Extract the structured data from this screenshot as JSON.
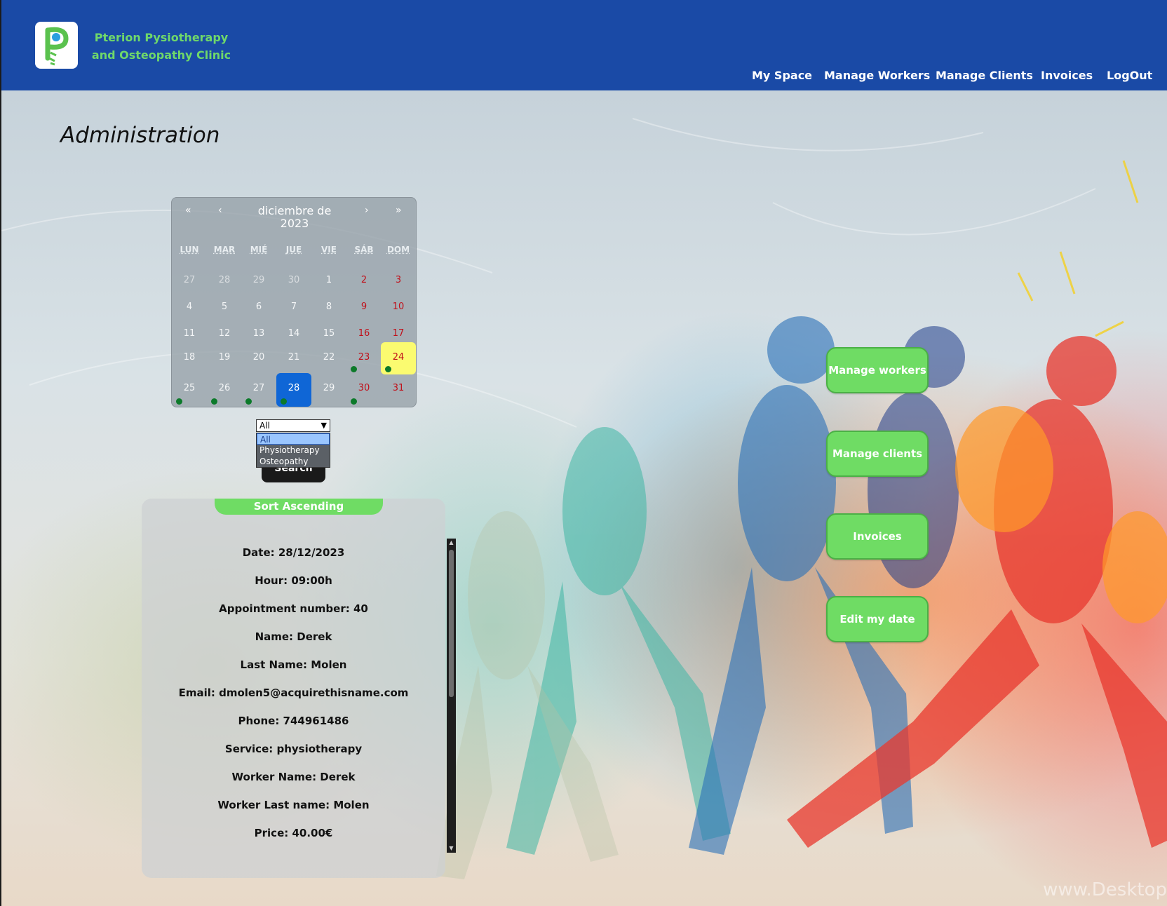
{
  "header": {
    "clinic_name": "Pterion Pysiotherapy and Osteopathy Clinic",
    "nav": [
      "My Space",
      "Manage Workers",
      "Manage Clients",
      "Invoices",
      "LogOut"
    ]
  },
  "page": {
    "title": "Administration",
    "watermark": "www.Desktop"
  },
  "calendar": {
    "prev_year": "«",
    "prev_month": "‹",
    "next_month": "›",
    "next_year": "»",
    "month_label": "diciembre de 2023",
    "weekdays": [
      "LUN",
      "MAR",
      "MIÉ",
      "JUE",
      "VIE",
      "SÁB",
      "DOM"
    ],
    "weeks": [
      [
        "27",
        "28",
        "29",
        "30",
        "1",
        "2",
        "3"
      ],
      [
        "4",
        "5",
        "6",
        "7",
        "8",
        "9",
        "10"
      ],
      [
        "11",
        "12",
        "13",
        "14",
        "15",
        "16",
        "17"
      ],
      [
        "18",
        "19",
        "20",
        "21",
        "22",
        "23",
        "24"
      ],
      [
        "25",
        "26",
        "27",
        "28",
        "29",
        "30",
        "31"
      ]
    ],
    "today": "24",
    "selected": "28",
    "days_with_appointments": [
      "23",
      "24",
      "25",
      "26",
      "27",
      "28",
      "30"
    ]
  },
  "filter": {
    "selected": "All",
    "options": [
      "All",
      "Physiotherapy",
      "Osteopathy"
    ],
    "search_label": "Search"
  },
  "appointment": {
    "sort_label": "Sort Ascending",
    "fields": [
      "Date: 28/12/2023",
      "Hour: 09:00h",
      "Appointment number: 40",
      "Name: Derek",
      "Last Name: Molen",
      "Email: dmolen5@acquirethisname.com",
      "Phone: 744961486",
      "Service: physiotherapy",
      "Worker Name: Derek",
      "Worker Last name: Molen",
      "Price: 40.00€"
    ]
  },
  "actions": [
    "Manage workers",
    "Manage clients",
    "Invoices",
    "Edit my date"
  ],
  "colors": {
    "header_bg": "#1a4aa6",
    "accent_green": "#6fdc64",
    "clinic_name": "#6fd86a",
    "today_bg": "#fbfb70",
    "selected_bg": "#0f66d6",
    "weekend_text": "#c0101a",
    "appointment_dot": "#0c7a2a"
  },
  "icons": {
    "logo": "clinic-logo-icon",
    "dropdown": "chevron-down-icon",
    "scroll_up": "arrow-up-icon",
    "scroll_down": "arrow-down-icon"
  }
}
